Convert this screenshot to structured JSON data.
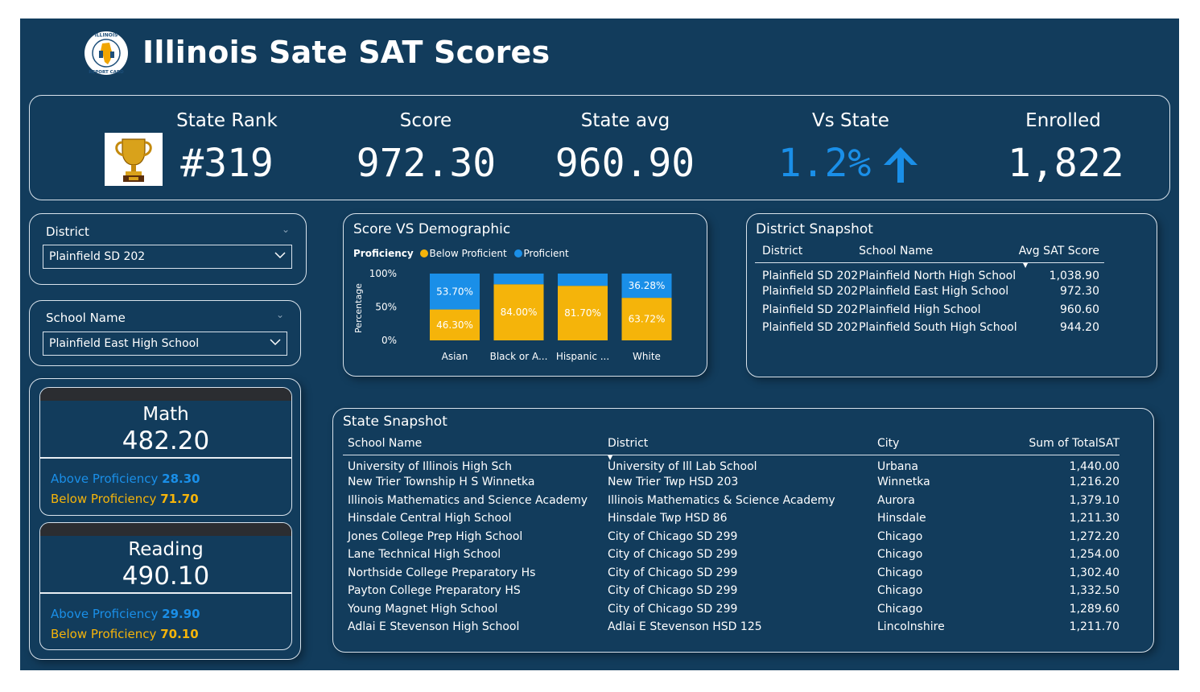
{
  "header": {
    "title": "Illinois Sate SAT Scores",
    "logo_text": "ILLINOIS REPORT CARD"
  },
  "kpis": {
    "rank": {
      "label": "State Rank",
      "value": "#319"
    },
    "score": {
      "label": "Score",
      "value": "972.30"
    },
    "state_avg": {
      "label": "State avg",
      "value": "960.90"
    },
    "vs_state": {
      "label": "Vs State",
      "value": "1.2%",
      "direction": "up",
      "color": "#1a8fe8"
    },
    "enrolled": {
      "label": "Enrolled",
      "value": "1,822"
    }
  },
  "slicers": {
    "district": {
      "title": "District",
      "selected": "Plainfield SD 202"
    },
    "school": {
      "title": "School Name",
      "selected": "Plainfield East High School"
    }
  },
  "subjects": [
    {
      "name": "Math",
      "score": "482.20",
      "above_label": "Above Proficiency",
      "above_value": "28.30",
      "below_label": "Below Proficiency",
      "below_value": "71.70"
    },
    {
      "name": "Reading",
      "score": "490.10",
      "above_label": "Above Proficiency",
      "above_value": "29.90",
      "below_label": "Below Proficiency",
      "below_value": "70.10"
    }
  ],
  "demographic_chart": {
    "title": "Score VS Demographic",
    "legend_title": "Proficiency",
    "colors": {
      "below": "#f5b40a",
      "proficient": "#1a8fe8"
    }
  },
  "chart_data": {
    "type": "bar",
    "stacked": true,
    "percent": true,
    "categories": [
      "Asian",
      "Black or A...",
      "Hispanic ...",
      "White"
    ],
    "series": [
      {
        "name": "Below Proficient",
        "values": [
          46.3,
          84.0,
          81.7,
          63.72
        ],
        "labels": [
          "46.30%",
          "84.00%",
          "81.70%",
          "63.72%"
        ]
      },
      {
        "name": "Proficient",
        "values": [
          53.7,
          16.0,
          18.3,
          36.28
        ],
        "labels": [
          "53.70%",
          "",
          "",
          "36.28%"
        ]
      }
    ],
    "title": "Score VS Demographic",
    "xlabel": "",
    "ylabel": "Percentage",
    "yticks": [
      "100%",
      "50%",
      "0%"
    ],
    "ylim": [
      0,
      100
    ]
  },
  "district_snapshot": {
    "title": "District Snapshot",
    "columns": [
      "District",
      "School Name",
      "Avg SAT Score"
    ],
    "rows": [
      [
        "Plainfield SD 202",
        "Plainfield North High School",
        "1,038.90"
      ],
      [
        "Plainfield SD 202",
        "Plainfield East High School",
        "972.30"
      ],
      [
        "Plainfield SD 202",
        "Plainfield High School",
        "960.60"
      ],
      [
        "Plainfield SD 202",
        "Plainfield South High School",
        "944.20"
      ]
    ]
  },
  "state_snapshot": {
    "title": "State Snapshot",
    "columns": [
      "School Name",
      "District",
      "City",
      "Sum of TotalSAT"
    ],
    "rows": [
      [
        "University of Illinois High Sch",
        "University of Ill Lab School",
        "Urbana",
        "1,440.00"
      ],
      [
        "New Trier Township H S Winnetka",
        "New Trier Twp HSD 203",
        "Winnetka",
        "1,216.20"
      ],
      [
        "Illinois Mathematics and Science Academy",
        "Illinois Mathematics & Science Academy",
        "Aurora",
        "1,379.10"
      ],
      [
        "Hinsdale Central High School",
        "Hinsdale Twp HSD 86",
        "Hinsdale",
        "1,211.30"
      ],
      [
        "Jones College Prep High School",
        "City of Chicago SD 299",
        "Chicago",
        "1,272.20"
      ],
      [
        "Lane Technical High School",
        "City of Chicago SD 299",
        "Chicago",
        "1,254.00"
      ],
      [
        "Northside College Preparatory Hs",
        "City of Chicago SD 299",
        "Chicago",
        "1,302.40"
      ],
      [
        "Payton College Preparatory HS",
        "City of Chicago SD 299",
        "Chicago",
        "1,332.50"
      ],
      [
        "Young Magnet High School",
        "City of Chicago SD 299",
        "Chicago",
        "1,289.60"
      ],
      [
        "Adlai E Stevenson High School",
        "Adlai E Stevenson HSD 125",
        "Lincolnshire",
        "1,211.70"
      ]
    ]
  }
}
